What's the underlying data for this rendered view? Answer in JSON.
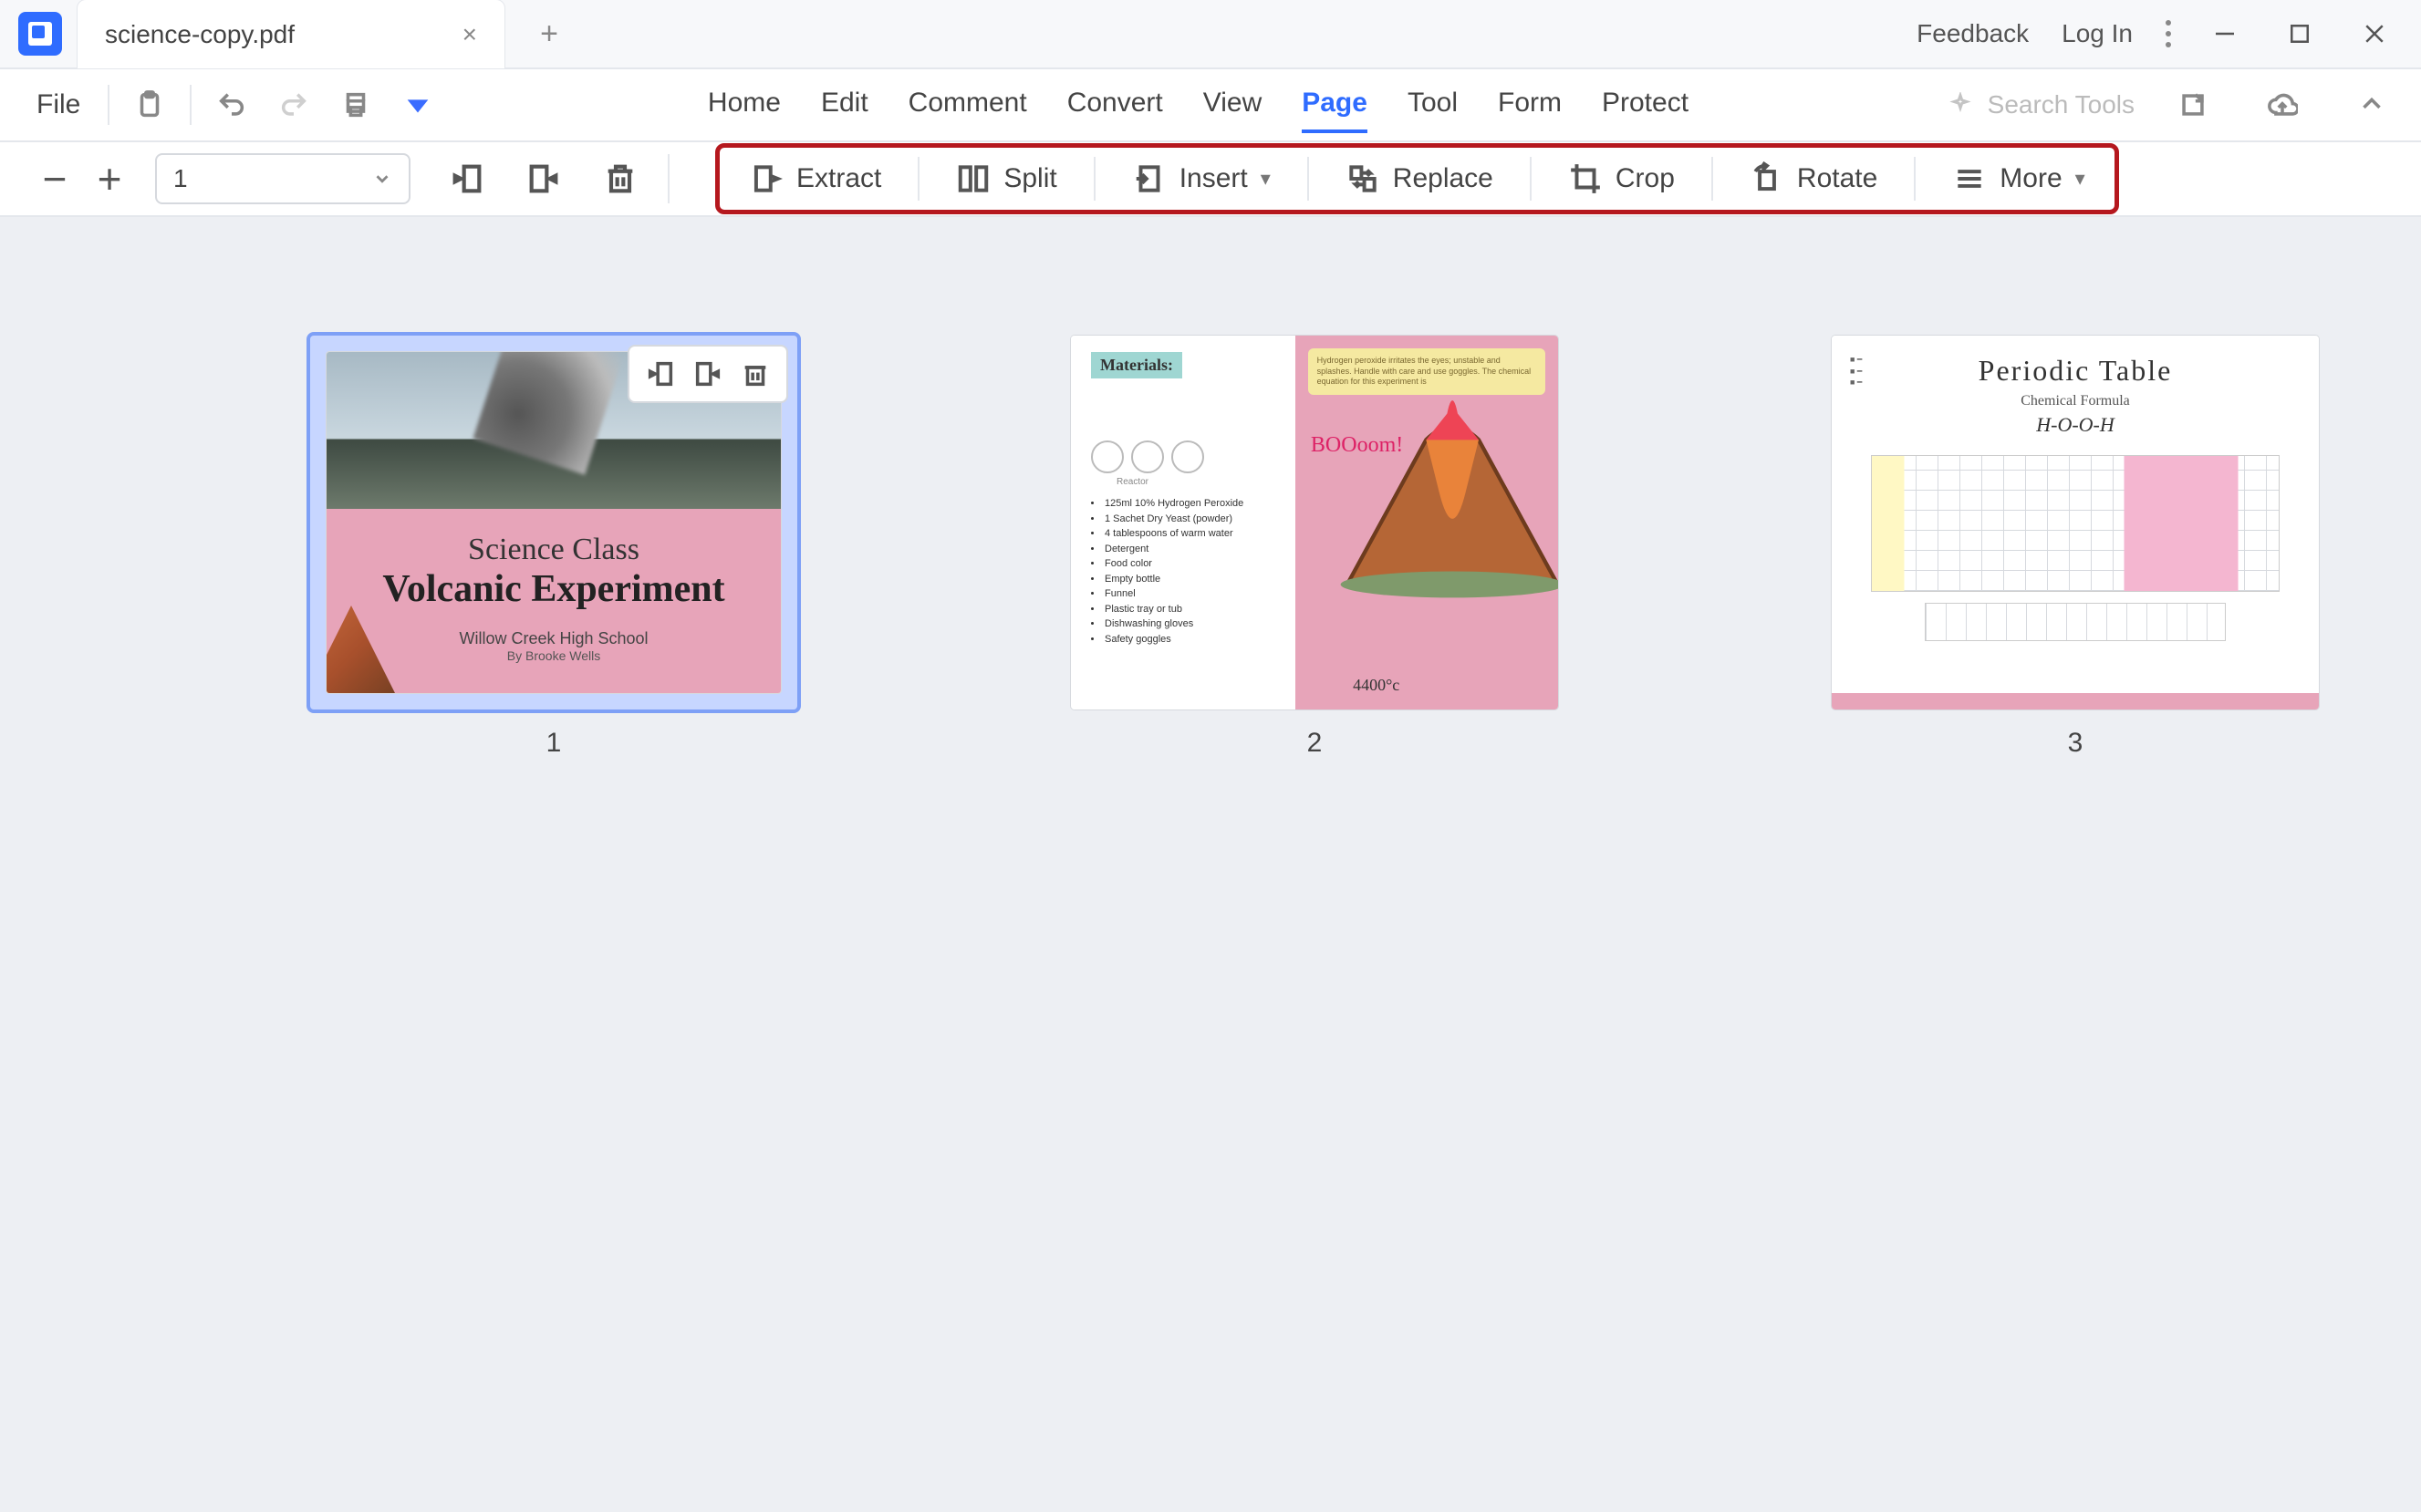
{
  "window": {
    "tab_title": "science-copy.pdf",
    "feedback": "Feedback",
    "login": "Log In"
  },
  "menu": {
    "file": "File",
    "items": [
      "Home",
      "Edit",
      "Comment",
      "Convert",
      "View",
      "Page",
      "Tool",
      "Form",
      "Protect"
    ],
    "active": "Page",
    "search_placeholder": "Search Tools"
  },
  "page_tools": {
    "page_input": "1",
    "extract": "Extract",
    "split": "Split",
    "insert": "Insert",
    "replace": "Replace",
    "crop": "Crop",
    "rotate": "Rotate",
    "more": "More"
  },
  "thumbs": {
    "p1": {
      "num": "1",
      "h1": "Science Class",
      "h2": "Volcanic Experiment",
      "school": "Willow Creek High School",
      "author": "By Brooke Wells"
    },
    "p2": {
      "num": "2",
      "tag": "Materials:",
      "items": [
        "125ml 10% Hydrogen Peroxide",
        "1 Sachet Dry Yeast (powder)",
        "4 tablespoons of warm water",
        "Detergent",
        "Food color",
        "Empty bottle",
        "Funnel",
        "Plastic tray or tub",
        "Dishwashing gloves",
        "Safety goggles"
      ],
      "note": "Hydrogen peroxide irritates the eyes; unstable and splashes. Handle with care and use goggles. The chemical equation for this experiment is",
      "boom": "BOOoom!",
      "temp": "4400°c",
      "reactor": "Reactor"
    },
    "p3": {
      "num": "3",
      "title": "Periodic Table",
      "sub": "Chemical Formula",
      "formula": "H-O-O-H"
    }
  }
}
